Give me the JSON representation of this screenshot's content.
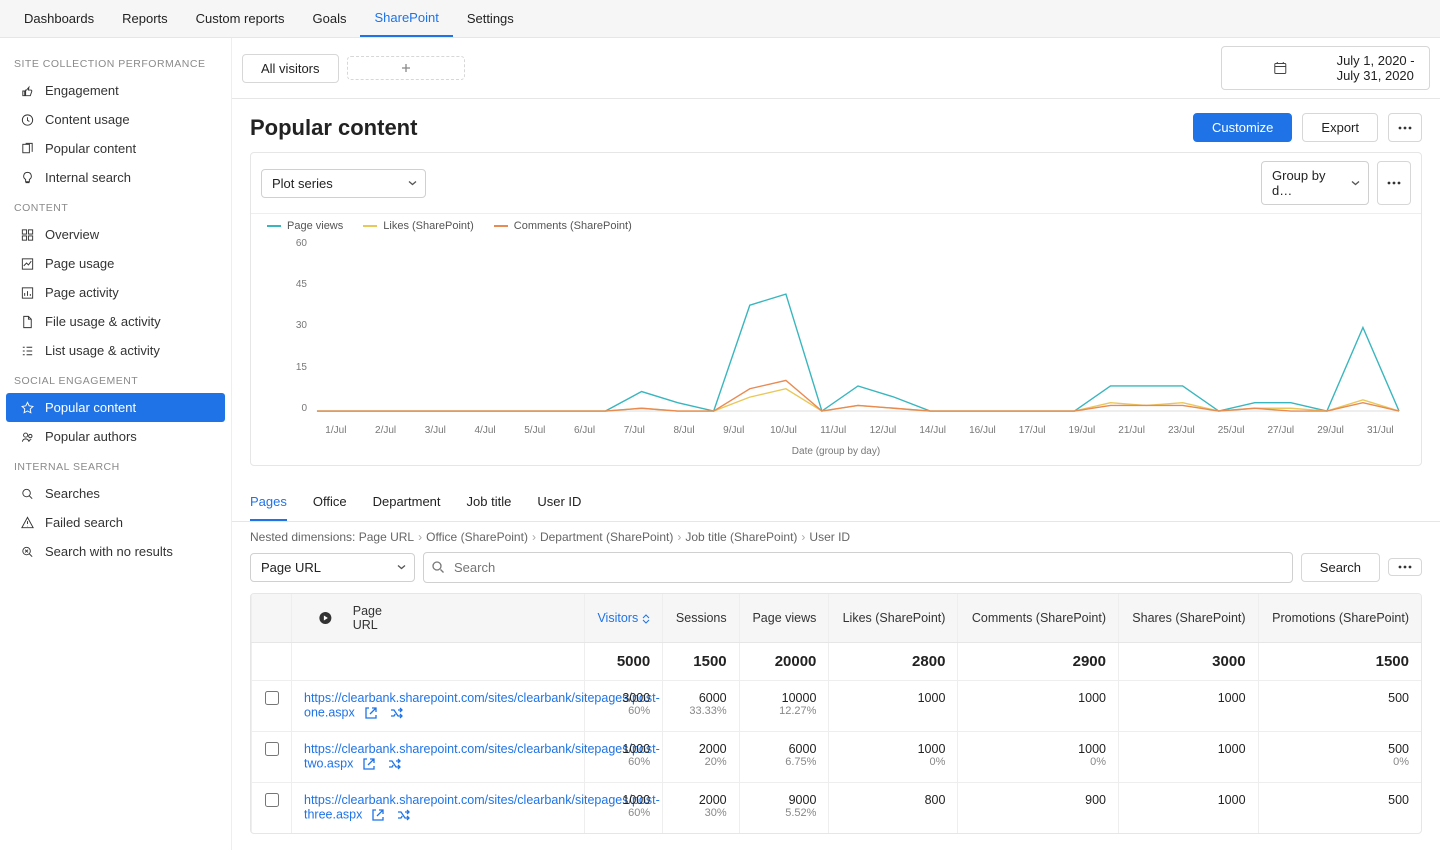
{
  "topnav": [
    "Dashboards",
    "Reports",
    "Custom reports",
    "Goals",
    "SharePoint",
    "Settings"
  ],
  "topnav_active": 4,
  "sidebar": {
    "sections": [
      {
        "title": "SITE COLLECTION PERFORMANCE",
        "items": [
          {
            "label": "Engagement",
            "icon": "thumbs"
          },
          {
            "label": "Content usage",
            "icon": "clock"
          },
          {
            "label": "Popular content",
            "icon": "copy"
          },
          {
            "label": "Internal search",
            "icon": "bulb"
          }
        ]
      },
      {
        "title": "CONTENT",
        "items": [
          {
            "label": "Overview",
            "icon": "grid"
          },
          {
            "label": "Page usage",
            "icon": "chart"
          },
          {
            "label": "Page activity",
            "icon": "bars"
          },
          {
            "label": "File usage & activity",
            "icon": "file"
          },
          {
            "label": "List usage & activity",
            "icon": "list"
          }
        ]
      },
      {
        "title": "SOCIAL ENGAGEMENT",
        "items": [
          {
            "label": "Popular content",
            "icon": "star",
            "active": true
          },
          {
            "label": "Popular authors",
            "icon": "users"
          }
        ]
      },
      {
        "title": "INTERNAL SEARCH",
        "items": [
          {
            "label": "Searches",
            "icon": "search"
          },
          {
            "label": "Failed search",
            "icon": "alert"
          },
          {
            "label": "Search with no results",
            "icon": "searchx"
          }
        ]
      }
    ]
  },
  "visitor_tab": "All visitors",
  "date_range": "July 1, 2020 - July 31, 2020",
  "page_title": "Popular content",
  "customize_label": "Customize",
  "export_label": "Export",
  "plot_select": "Plot series",
  "group_select": "Group by d…",
  "xaxis_caption": "Date (group by day)",
  "chart_data": {
    "type": "line",
    "xlabel": "Date (group by day)",
    "ylabel": "",
    "ylim": [
      0,
      60
    ],
    "yticks": [
      0,
      15,
      30,
      45,
      60
    ],
    "x": [
      "1/Jul",
      "2/Jul",
      "3/Jul",
      "4/Jul",
      "5/Jul",
      "6/Jul",
      "7/Jul",
      "8/Jul",
      "9/Jul",
      "10/Jul",
      "11/Jul",
      "12/Jul",
      "13/Jul",
      "14/Jul",
      "15/Jul",
      "16/Jul",
      "17/Jul",
      "18/Jul",
      "19/Jul",
      "20/Jul",
      "21/Jul",
      "22/Jul",
      "23/Jul",
      "24/Jul",
      "25/Jul",
      "26/Jul",
      "27/Jul",
      "28/Jul",
      "29/Jul",
      "30/Jul",
      "31/Jul"
    ],
    "xlabels": [
      "1/Jul",
      "2/Jul",
      "3/Jul",
      "4/Jul",
      "5/Jul",
      "6/Jul",
      "7/Jul",
      "8/Jul",
      "9/Jul",
      "10/Jul",
      "11/Jul",
      "12/Jul",
      "14/Jul",
      "16/Jul",
      "17/Jul",
      "19/Jul",
      "21/Jul",
      "23/Jul",
      "25/Jul",
      "27/Jul",
      "29/Jul",
      "31/Jul"
    ],
    "series": [
      {
        "name": "Page views",
        "color": "#39b6bd",
        "values": [
          0,
          0,
          0,
          0,
          0,
          0,
          0,
          0,
          0,
          7,
          3,
          0,
          38,
          42,
          0,
          9,
          5,
          0,
          0,
          0,
          0,
          0,
          9,
          9,
          9,
          0,
          3,
          3,
          0,
          30,
          0
        ]
      },
      {
        "name": "Likes (SharePoint)",
        "color": "#e8c85a",
        "values": [
          0,
          0,
          0,
          0,
          0,
          0,
          0,
          0,
          0,
          1,
          0,
          0,
          5,
          8,
          0,
          2,
          1,
          0,
          0,
          0,
          0,
          0,
          3,
          2,
          3,
          0,
          1,
          1,
          0,
          4,
          0
        ]
      },
      {
        "name": "Comments (SharePoint)",
        "color": "#e98a52",
        "values": [
          0,
          0,
          0,
          0,
          0,
          0,
          0,
          0,
          0,
          1,
          0,
          0,
          8,
          11,
          0,
          2,
          1,
          0,
          0,
          0,
          0,
          0,
          2,
          2,
          2,
          0,
          1,
          0,
          0,
          3,
          0
        ]
      }
    ]
  },
  "tabs": [
    "Pages",
    "Office",
    "Department",
    "Job title",
    "User ID"
  ],
  "tabs_active": 0,
  "nd_label": "Nested dimensions:",
  "nd_items": [
    "Page URL",
    "Office (SharePoint)",
    "Department (SharePoint)",
    "Job title (SharePoint)",
    "User ID"
  ],
  "dim_select": "Page URL",
  "search_placeholder": "Search",
  "search_button": "Search",
  "table": {
    "first_header_label": "Page URL",
    "headers": [
      "Visitors",
      "Sessions",
      "Page views",
      "Likes (SharePoint)",
      "Comments (SharePoint)",
      "Shares (SharePoint)",
      "Promotions (SharePoint)"
    ],
    "sort_col": 0,
    "totals": [
      "5000",
      "1500",
      "20000",
      "2800",
      "2900",
      "3000",
      "1500"
    ],
    "rows": [
      {
        "url": "https://clearbank.sharepoint.com/sites/clearbank/sitepages/post-one.aspx",
        "cells": [
          {
            "v": "3000",
            "s": "60%"
          },
          {
            "v": "6000",
            "s": "33.33%"
          },
          {
            "v": "10000",
            "s": "12.27%"
          },
          {
            "v": "1000",
            "s": ""
          },
          {
            "v": "1000",
            "s": ""
          },
          {
            "v": "1000",
            "s": ""
          },
          {
            "v": "500",
            "s": ""
          }
        ]
      },
      {
        "url": "https://clearbank.sharepoint.com/sites/clearbank/sitepages/post-two.aspx",
        "cells": [
          {
            "v": "1000",
            "s": "60%"
          },
          {
            "v": "2000",
            "s": "20%"
          },
          {
            "v": "6000",
            "s": "6.75%"
          },
          {
            "v": "1000",
            "s": "0%"
          },
          {
            "v": "1000",
            "s": "0%"
          },
          {
            "v": "1000",
            "s": ""
          },
          {
            "v": "500",
            "s": "0%"
          }
        ]
      },
      {
        "url": "https://clearbank.sharepoint.com/sites/clearbank/sitepages/post-three.aspx",
        "cells": [
          {
            "v": "1000",
            "s": "60%"
          },
          {
            "v": "2000",
            "s": "30%"
          },
          {
            "v": "9000",
            "s": "5.52%"
          },
          {
            "v": "800",
            "s": ""
          },
          {
            "v": "900",
            "s": ""
          },
          {
            "v": "1000",
            "s": ""
          },
          {
            "v": "500",
            "s": ""
          }
        ]
      }
    ]
  }
}
